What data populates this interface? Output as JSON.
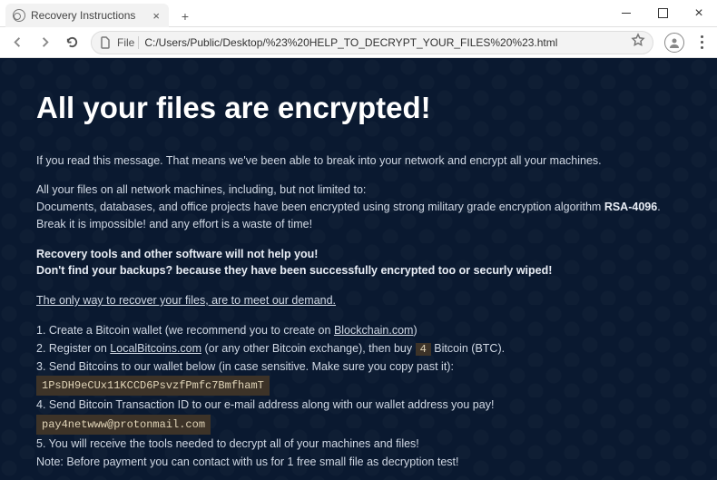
{
  "browser": {
    "tab_title": "Recovery Instructions",
    "file_label": "File",
    "url": "C:/Users/Public/Desktop/%23%20HELP_TO_DECRYPT_YOUR_FILES%20%23.html"
  },
  "page": {
    "heading": "All your files are encrypted!",
    "intro": "If you read this message. That means we've been able to break into your network and encrypt all your machines.",
    "files_line": "All your files on all network machines, including, but not limited to:",
    "docs_prefix": "Documents, databases, and office projects have been encrypted using strong military grade encryption algorithm ",
    "algo": "RSA-4096",
    "break_line": "Break it is impossible! and any effort is a waste of time!",
    "recovery_line": "Recovery tools and other software will not help you!",
    "backups_line": "Don't find your backups? because they have been successfully encrypted too or securly wiped!",
    "only_way": "The only way to recover your files, are to meet our demand.",
    "steps": {
      "s1a": "1. Create a Bitcoin wallet (we recommend you to create on ",
      "s1_link": "Blockchain.com",
      "s1b": ")",
      "s2a": "2. Register on ",
      "s2_link": "LocalBitcoins.com",
      "s2b": " (or any other Bitcoin exchange), then buy ",
      "s2_num": "4",
      "s2c": " Bitcoin (BTC).",
      "s3": "3. Send Bitcoins to our wallet below (in case sensitive. Make sure you copy past it):",
      "wallet": "1PsDH9eCUx11KCCD6PsvzfPmfc7BmfhamT",
      "s4": "4. Send Bitcoin Transaction ID to our e-mail address along with our wallet address you pay!",
      "email": "pay4netwww@protonmail.com",
      "s5": "5. You will receive the tools needed to decrypt all of your machines and files!",
      "note": "Note: Before payment you can contact with us for 1 free small file as decryption test!"
    }
  }
}
